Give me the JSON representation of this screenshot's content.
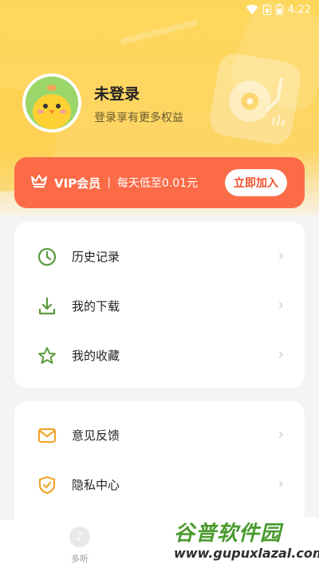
{
  "status_bar": {
    "time": "4:22"
  },
  "profile": {
    "name": "未登录",
    "subtitle": "登录享有更多权益"
  },
  "vip": {
    "title": "VIP会员",
    "separator": "|",
    "description": "每天低至0.01元",
    "button_label": "立即加入"
  },
  "menu_group_1": [
    {
      "label": "历史记录",
      "icon": "clock-icon"
    },
    {
      "label": "我的下载",
      "icon": "download-icon"
    },
    {
      "label": "我的收藏",
      "icon": "star-icon"
    }
  ],
  "menu_group_2": [
    {
      "label": "意见反馈",
      "icon": "mail-icon"
    },
    {
      "label": "隐私中心",
      "icon": "shield-icon"
    }
  ],
  "tabbar": {
    "tab1_label": "多听"
  },
  "watermark": {
    "title": "谷普软件园",
    "url": "www.gupuxlazal.com"
  },
  "colors": {
    "header_yellow": "#fed75a",
    "vip_orange": "#fb6b48",
    "icon_green": "#5a9a3c",
    "icon_orange": "#f1a52c"
  }
}
